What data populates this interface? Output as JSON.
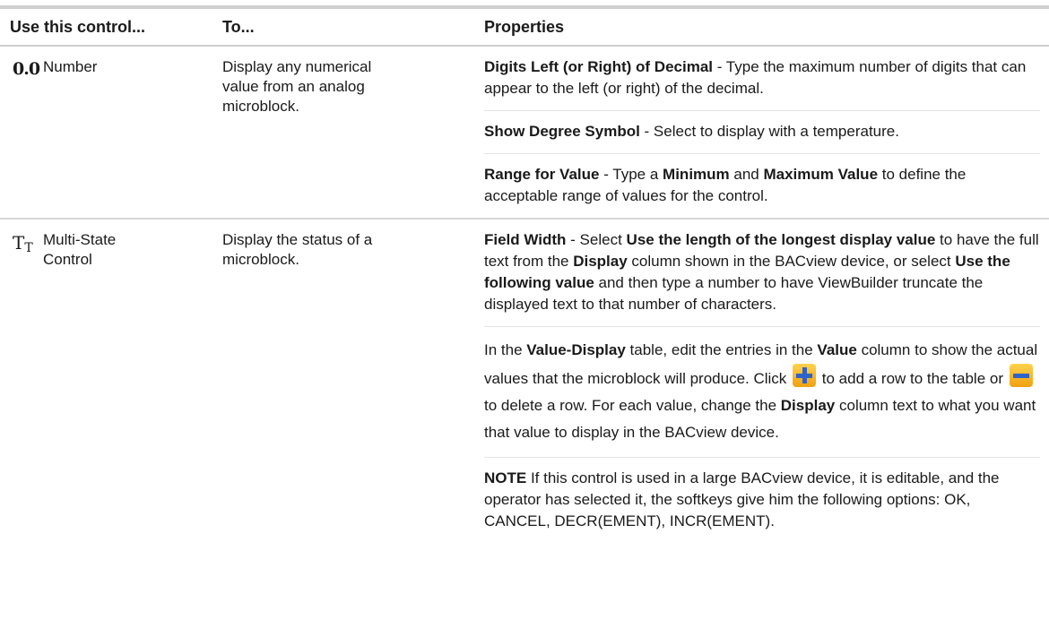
{
  "header": {
    "col1": "Use this control...",
    "col2": "To...",
    "col3": "Properties"
  },
  "rows": [
    {
      "icon": "number-icon",
      "icon_text": "0.0",
      "name": "Number",
      "to": "Display any numerical value from an analog microblock.",
      "props": {
        "p1_b1": "Digits Left (or Right) of Decimal",
        "p1_t1": " - Type the maximum number of digits that can appear to the left (or right) of the decimal.",
        "p2_b1": "Show Degree Symbol",
        "p2_t1": " - Select to display with a temperature.",
        "p3_b1": "Range for Value",
        "p3_t1": " - Type a ",
        "p3_b2": "Minimum",
        "p3_t2": " and ",
        "p3_b3": "Maximum Value",
        "p3_t3": " to define the acceptable range of values for the control."
      }
    },
    {
      "icon": "multi-state-icon",
      "icon_text_big": "T",
      "icon_text_small": "T",
      "name": "Multi-State Control",
      "to": "Display the status of a microblock.",
      "props": {
        "p1_b1": "Field Width",
        "p1_t1": " - Select ",
        "p1_b2": "Use the length of the longest display value",
        "p1_t2": " to have the full text from the ",
        "p1_b3": "Display",
        "p1_t3": " column shown in the BACview device, or select ",
        "p1_b4": "Use the following value",
        "p1_t4": " and then type a number to have ViewBuilder truncate the displayed text to that number of characters.",
        "p2_t1": "In the ",
        "p2_b1": "Value-Display",
        "p2_t2": " table, edit the entries in the ",
        "p2_b2": "Value",
        "p2_t3": " column to show the actual values that the microblock will produce. Click ",
        "p2_t4": " to add a row to the table or ",
        "p2_t5": " to delete a row. For each value, change the ",
        "p2_b3": "Display",
        "p2_t6": " column text to what you want that value to display in the BACview device.",
        "p3_b1": "NOTE",
        "p3_t1": "  If this control is used in a large BACview device, it is editable, and the operator has selected it, the softkeys give him the following options: OK, CANCEL, DECR(EMENT), INCR(EMENT)."
      }
    }
  ]
}
